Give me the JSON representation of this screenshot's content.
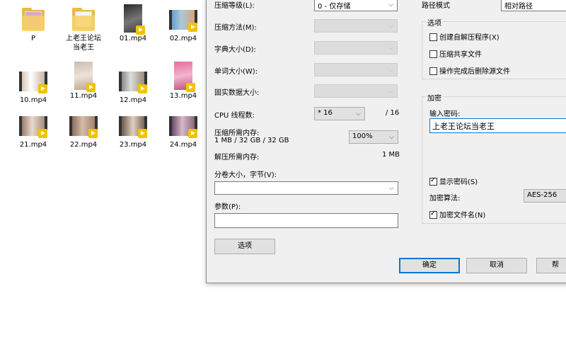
{
  "desktop": {
    "files": [
      {
        "name": "P",
        "kind": "folder"
      },
      {
        "name": "上老王论坛\n当老王",
        "kind": "folder"
      },
      {
        "name": "01.mp4",
        "kind": "video"
      },
      {
        "name": "02.mp4",
        "kind": "video"
      },
      {
        "name": "10.mp4",
        "kind": "video"
      },
      {
        "name": "11.mp4",
        "kind": "video"
      },
      {
        "name": "12.mp4",
        "kind": "video"
      },
      {
        "name": "13.mp4",
        "kind": "video"
      },
      {
        "name": "21.mp4",
        "kind": "video"
      },
      {
        "name": "22.mp4",
        "kind": "video"
      },
      {
        "name": "23.mp4",
        "kind": "video"
      },
      {
        "name": "24.mp4",
        "kind": "video"
      }
    ]
  },
  "dialog": {
    "compression_level_label": "压缩等级(L):",
    "compression_level_value": "0 - 仅存储",
    "compression_method_label": "压缩方法(M):",
    "dictionary_size_label": "字典大小(D):",
    "word_size_label": "单词大小(W):",
    "solid_block_label": "固实数据大小:",
    "cpu_threads_label": "CPU 线程数:",
    "cpu_threads_value": "* 16",
    "cpu_threads_total": "/ 16",
    "memory_compress_label": "压缩所需内存:",
    "memory_compress_value": "1 MB / 32 GB / 32 GB",
    "memory_percent": "100%",
    "memory_decompress_label": "解压所需内存:",
    "memory_decompress_value": "1 MB",
    "volume_label": "分卷大小，字节(V):",
    "volume_value": "",
    "params_label": "参数(P):",
    "params_value": "",
    "options_button": "选项",
    "path_mode_label": "路径模式",
    "path_mode_value": "相对路径",
    "options_group_title": "选项",
    "option_sfx": "创建自解压程序(X)",
    "option_shared": "压缩共享文件",
    "option_delete": "操作完成后删除源文件",
    "encryption_group_title": "加密",
    "password_label": "输入密码:",
    "password_value": "上老王论坛当老王",
    "show_password": "显示密码(S)",
    "encryption_method_label": "加密算法:",
    "encryption_method_value": "AES-256",
    "encrypt_names": "加密文件名(N)",
    "ok_button": "确定",
    "cancel_button": "取消",
    "help_button": "帮"
  },
  "colors": {
    "accent": "#0078d7",
    "dialog_bg": "#f0f0f0",
    "play_badge": "#f2c200"
  }
}
